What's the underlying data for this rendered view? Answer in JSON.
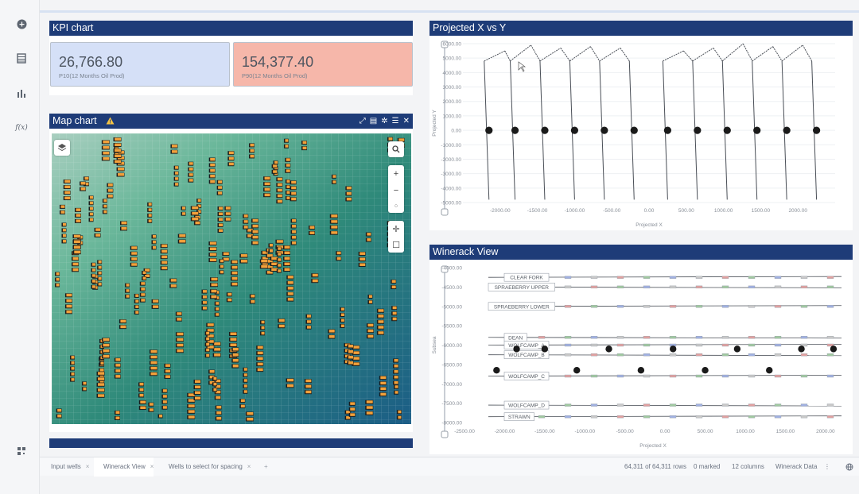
{
  "kpi": {
    "title": "KPI chart",
    "cards": [
      {
        "value": "26,766.80",
        "label": "P10(12 Months Oil Prod)",
        "color": "#d5e0f7"
      },
      {
        "value": "154,377.40",
        "label": "P90(12 Months Oil Prod)",
        "color": "#f6b7aa"
      }
    ]
  },
  "map": {
    "title": "Map chart",
    "warning_icon": "warning-triangle-icon",
    "tools": [
      "expand-icon",
      "legend-icon",
      "settings-icon",
      "list-icon",
      "close-icon"
    ],
    "controls": [
      "layers-icon",
      "search-icon",
      "zoom-in-icon",
      "zoom-out-icon",
      "reset-view-icon",
      "pan-icon",
      "select-box-icon"
    ],
    "zoom_in": "+",
    "zoom_out": "−"
  },
  "projected": {
    "title": "Projected X vs Y",
    "ylabel": "Projected Y",
    "xlabel": "Projected X",
    "y_ticks": [
      "6000.00",
      "5000.00",
      "4000.00",
      "3000.00",
      "2000.00",
      "1000.00",
      "0.00",
      "-1000.00",
      "-2000.00",
      "-3000.00",
      "-4000.00",
      "-5000.00"
    ],
    "x_ticks": [
      "-2000.00",
      "-1500.00",
      "-1000.00",
      "-500.00",
      "0.00",
      "500.00",
      "1000.00",
      "1500.00",
      "2000.00"
    ],
    "wells_x": [
      -2150,
      -1800,
      -1400,
      -1000,
      -600,
      -200,
      250,
      650,
      1050,
      1450,
      1850,
      2250
    ]
  },
  "winerack": {
    "title": "Winerack View",
    "ylabel": "Subsea",
    "xlabel": "Projected X",
    "y_ticks": [
      "-4000.00",
      "-4500.00",
      "-5000.00",
      "-5500.00",
      "-6000.00",
      "-6500.00",
      "-7000.00",
      "-7500.00",
      "-8000.00"
    ],
    "x_ticks": [
      "-2500.00",
      "-2000.00",
      "-1500.00",
      "-1000.00",
      "-500.00",
      "0.00",
      "500.00",
      "1000.00",
      "1500.00",
      "2000.00"
    ],
    "formations": [
      {
        "name": "CLEAR FORK",
        "depth": -4250
      },
      {
        "name": "SPRAEBERRY UPPER",
        "depth": -4500
      },
      {
        "name": "SPRAEBERRY LOWER",
        "depth": -5000
      },
      {
        "name": "DEAN",
        "depth": -5800
      },
      {
        "name": "WOLFCAMP_A",
        "depth": -6000
      },
      {
        "name": "WOLFCAMP_B",
        "depth": -6250
      },
      {
        "name": "WOLFCAMP_C",
        "depth": -6800
      },
      {
        "name": "WOLFCAMP_D",
        "depth": -7550
      },
      {
        "name": "STRAWN",
        "depth": -7850
      }
    ],
    "wells": [
      {
        "x": -2100,
        "depth": -6650
      },
      {
        "x": -1850,
        "depth": -6100
      },
      {
        "x": -1500,
        "depth": -6100
      },
      {
        "x": -1100,
        "depth": -6650
      },
      {
        "x": -700,
        "depth": -6100
      },
      {
        "x": -300,
        "depth": -6650
      },
      {
        "x": 100,
        "depth": -6100
      },
      {
        "x": 500,
        "depth": -6650
      },
      {
        "x": 900,
        "depth": -6100
      },
      {
        "x": 1300,
        "depth": -6650
      },
      {
        "x": 1700,
        "depth": -6100
      },
      {
        "x": 2100,
        "depth": -6100
      }
    ]
  },
  "tabs": [
    {
      "label": "Input wells",
      "close": "×"
    },
    {
      "label": "Winerack View",
      "close": "×"
    },
    {
      "label": "Wells to select for spacing",
      "close": "×"
    }
  ],
  "add_tab": "+",
  "status": {
    "rows": "64,311 of 64,311 rows",
    "marked": "0 marked",
    "columns": "12 columns",
    "table": "Winerack Data",
    "more": "⋮"
  },
  "colors": {
    "header": "#1e3c78",
    "accent": "#f2a03a"
  }
}
